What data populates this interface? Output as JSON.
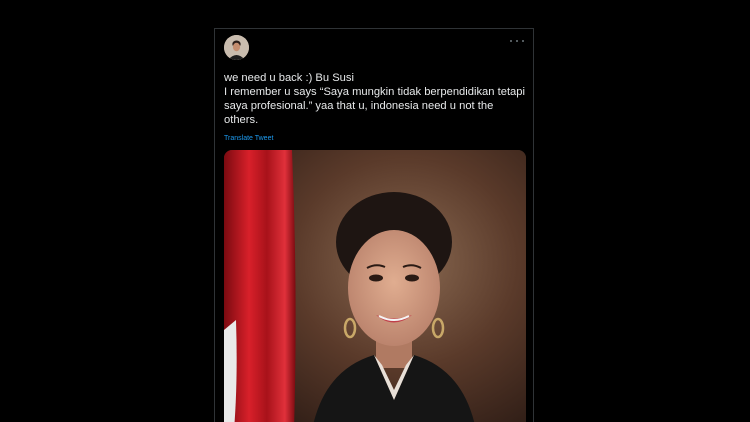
{
  "tweet": {
    "text": "we need u back :) Bu Susi\nI remember u says “Saya mungkin tidak berpendidikan tetapi saya profesional.” yaa that u, indonesia need u not the others.",
    "translate_label": "Translate Tweet",
    "avatar_icon": "profile-photo",
    "more_icon": "more-horizontal-icon"
  },
  "media": {
    "icon": "photo",
    "colors": {
      "flag_red": "#c8141e",
      "flag_white": "#f2f2f2",
      "background": "#5a3a2a",
      "jacket": "#151515"
    }
  },
  "colors": {
    "page_background": "#000000",
    "text": "#e7e9ea",
    "link": "#1d9bf0",
    "muted": "#6e767d"
  }
}
